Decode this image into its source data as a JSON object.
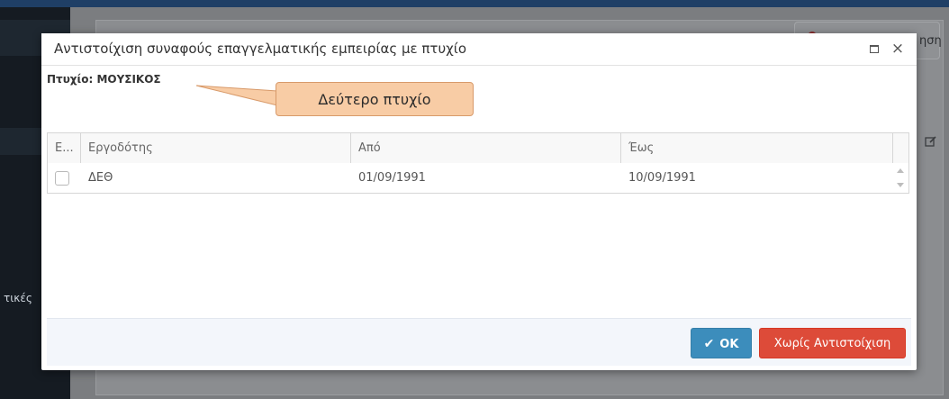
{
  "background": {
    "sidebar_text": "τικές",
    "search_text": "ηση"
  },
  "dialog": {
    "title": "Αντιστοίχιση συναφούς επαγγελματικής εμπειρίας με πτυχίο",
    "degree_label": "Πτυχίο: ΜΟΥΣΙΚΟΣ",
    "callout_text": "Δεύτερο πτυχίο",
    "close_symbol": "×"
  },
  "grid": {
    "columns": [
      "E...",
      "Εργοδότης",
      "Από",
      "Έως"
    ],
    "rows": [
      {
        "checked": false,
        "employer": "ΔΕΘ",
        "from": "01/09/1991",
        "to": "10/09/1991"
      }
    ]
  },
  "footer": {
    "ok_label": "OK",
    "ok_icon": "✔",
    "no_match_label": "Χωρίς Αντιστοίχιση"
  },
  "colors": {
    "ok_button": "#3c8dbc",
    "no_match_button": "#dd4b39",
    "callout_fill": "#f8cca5",
    "callout_border": "#d89a6a"
  }
}
